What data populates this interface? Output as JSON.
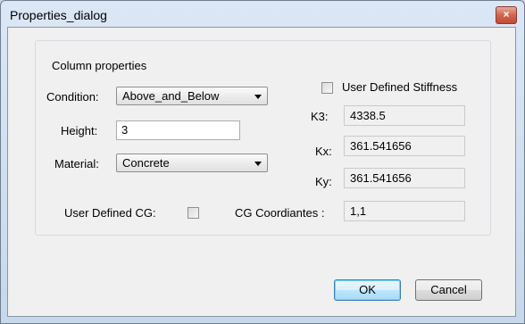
{
  "window": {
    "title": "Properties_dialog",
    "close_glyph": "×"
  },
  "group": {
    "title": "Column properties"
  },
  "condition": {
    "label": "Condition:",
    "value": "Above_and_Below"
  },
  "height": {
    "label": "Height:",
    "value": "3"
  },
  "material": {
    "label": "Material:",
    "value": "Concrete"
  },
  "user_defined_stiffness": {
    "label": "User Defined Stiffness",
    "checked": false
  },
  "stiffness": {
    "k3_label": "K3:",
    "k3_value": "4338.5",
    "kx_label": "Kx:",
    "kx_value": "361.541656",
    "ky_label": "Ky:",
    "ky_value": "361.541656"
  },
  "user_defined_cg": {
    "label": "User Defined CG:",
    "checked": false
  },
  "cg_coordinates": {
    "label": "CG Coordiantes :",
    "value": "1,1"
  },
  "buttons": {
    "ok": "OK",
    "cancel": "Cancel"
  }
}
